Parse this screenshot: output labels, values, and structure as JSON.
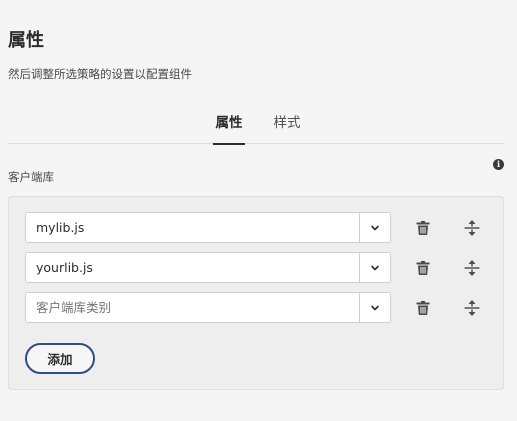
{
  "header": {
    "title": "属性",
    "subtitle": "然后调整所选策略的设置以配置组件"
  },
  "tabs": [
    {
      "label": "属性",
      "active": true
    },
    {
      "label": "样式",
      "active": false
    }
  ],
  "section": {
    "label": "客户端库",
    "info_icon": "info-icon"
  },
  "libraries": [
    {
      "value": "mylib.js",
      "placeholder": ""
    },
    {
      "value": "yourlib.js",
      "placeholder": ""
    },
    {
      "value": "",
      "placeholder": "客户端库类别"
    }
  ],
  "icons": {
    "dropdown": "chevron-down-icon",
    "delete": "trash-icon",
    "reorder": "move-vertical-icon"
  },
  "actions": {
    "add_label": "添加"
  },
  "colors": {
    "accent": "#2c4f8a",
    "text": "#2c2c2c",
    "background": "#f5f5f5"
  }
}
